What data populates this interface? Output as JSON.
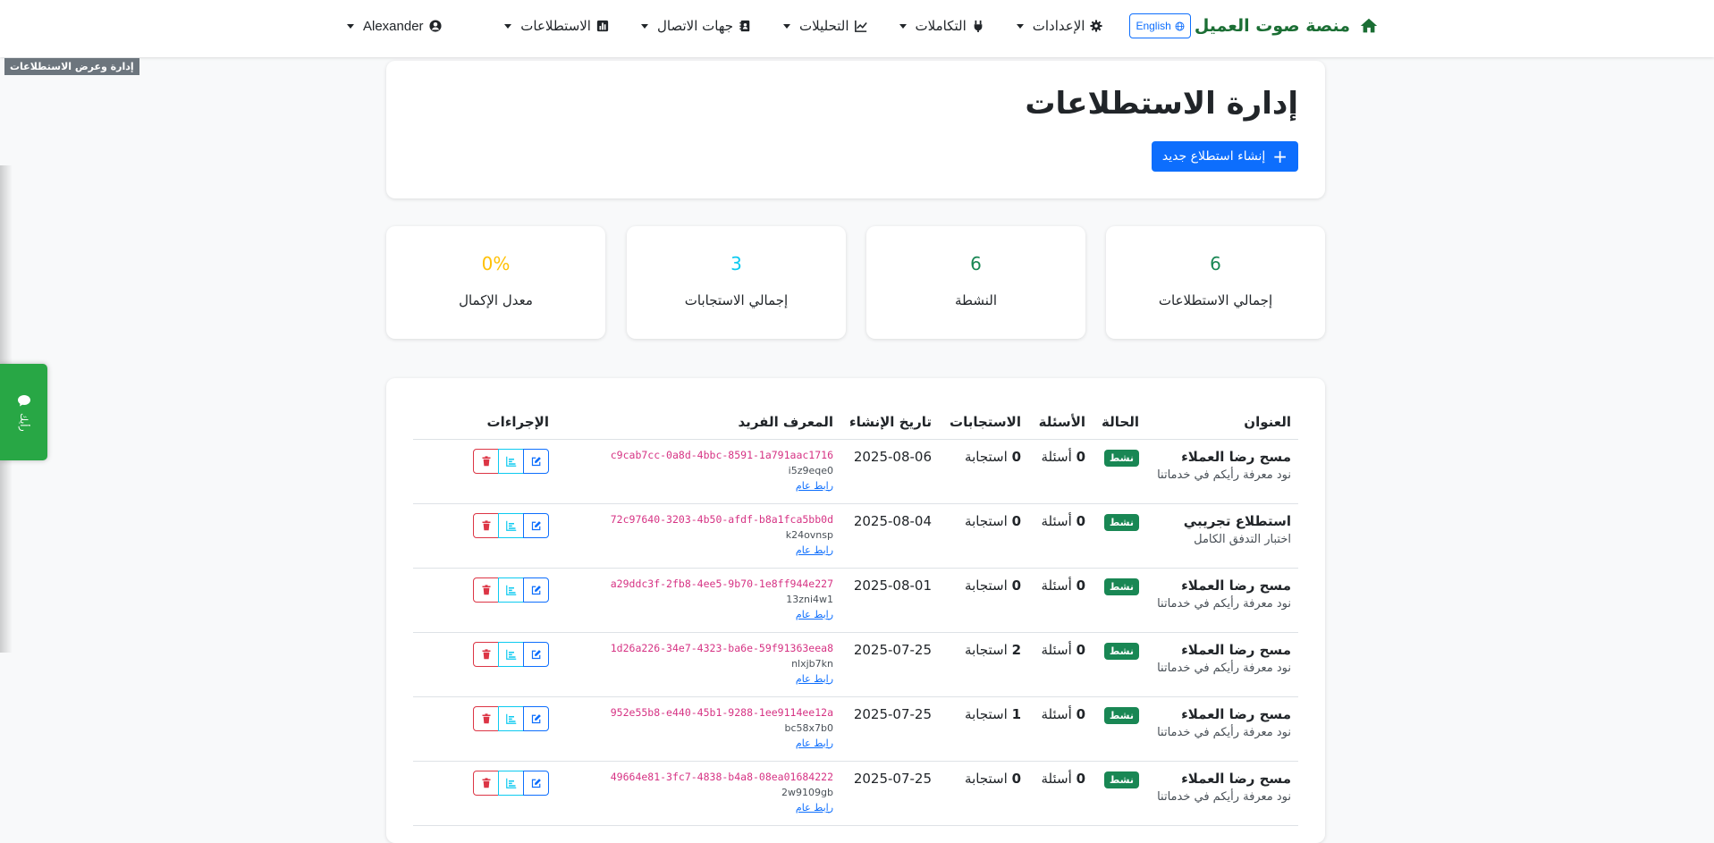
{
  "nav": {
    "brand": "منصة صوت العميل",
    "lang_button": "English",
    "items": [
      {
        "label": "الإعدادات",
        "icon": "gear-icon"
      },
      {
        "label": "التكاملات",
        "icon": "plug-icon"
      },
      {
        "label": "التحليلات",
        "icon": "line-chart-icon"
      },
      {
        "label": "جهات الاتصال",
        "icon": "contact-book-icon"
      },
      {
        "label": "الاستطلاعات",
        "icon": "poll-icon"
      }
    ],
    "user": "Alexander"
  },
  "tooltip": "إدارة وعرض الاستطلاعات",
  "feedback_tab": "رأيك",
  "header": {
    "title": "إدارة الاستطلاعات",
    "create_button": "إنشاء استطلاع جديد"
  },
  "stats": [
    {
      "value": "6",
      "label": "إجمالي الاستطلاعات",
      "color": "#198754"
    },
    {
      "value": "6",
      "label": "النشطة",
      "color": "#198754"
    },
    {
      "value": "3",
      "label": "إجمالي الاستجابات",
      "color": "#0dcaf0"
    },
    {
      "value": "0%",
      "label": "معدل الإكمال",
      "color": "#ffc107"
    }
  ],
  "table": {
    "headers": {
      "title": "العنوان",
      "status": "الحالة",
      "questions": "الأسئلة",
      "responses": "الاستجابات",
      "created": "تاريخ الإنشاء",
      "uid": "المعرف الفريد",
      "actions": "الإجراءات"
    },
    "rows": [
      {
        "title": "مسح رضا العملاء",
        "desc": "نود معرفة رأيكم في خدماتنا",
        "status": "نشط",
        "questions": "0",
        "questions_unit": "أسئلة",
        "responses": "0",
        "responses_unit": "استجابة",
        "created": "2025-08-06",
        "uuid": "c9cab7cc-0a8d-4bbc-8591-1a791aac1716",
        "slug": "i5z9eqe0",
        "link": "رابط عام"
      },
      {
        "title": "استطلاع تجريبي",
        "desc": "اختبار التدفق الكامل",
        "status": "نشط",
        "questions": "0",
        "questions_unit": "أسئلة",
        "responses": "0",
        "responses_unit": "استجابة",
        "created": "2025-08-04",
        "uuid": "72c97640-3203-4b50-afdf-b8a1fca5bb0d",
        "slug": "k24ovnsp",
        "link": "رابط عام"
      },
      {
        "title": "مسح رضا العملاء",
        "desc": "نود معرفة رأيكم في خدماتنا",
        "status": "نشط",
        "questions": "0",
        "questions_unit": "أسئلة",
        "responses": "0",
        "responses_unit": "استجابة",
        "created": "2025-08-01",
        "uuid": "a29ddc3f-2fb8-4ee5-9b70-1e8ff944e227",
        "slug": "13zni4w1",
        "link": "رابط عام"
      },
      {
        "title": "مسح رضا العملاء",
        "desc": "نود معرفة رأيكم في خدماتنا",
        "status": "نشط",
        "questions": "0",
        "questions_unit": "أسئلة",
        "responses": "2",
        "responses_unit": "استجابة",
        "created": "2025-07-25",
        "uuid": "1d26a226-34e7-4323-ba6e-59f91363eea8",
        "slug": "nlxjb7kn",
        "link": "رابط عام"
      },
      {
        "title": "مسح رضا العملاء",
        "desc": "نود معرفة رأيكم في خدماتنا",
        "status": "نشط",
        "questions": "0",
        "questions_unit": "أسئلة",
        "responses": "1",
        "responses_unit": "استجابة",
        "created": "2025-07-25",
        "uuid": "952e55b8-e440-45b1-9288-1ee9114ee12a",
        "slug": "bc58x7b0",
        "link": "رابط عام"
      },
      {
        "title": "مسح رضا العملاء",
        "desc": "نود معرفة رأيكم في خدماتنا",
        "status": "نشط",
        "questions": "0",
        "questions_unit": "أسئلة",
        "responses": "0",
        "responses_unit": "استجابة",
        "created": "2025-07-25",
        "uuid": "49664e81-3fc7-4838-b4a8-08ea01684222",
        "slug": "2w9109gb",
        "link": "رابط عام"
      }
    ]
  }
}
